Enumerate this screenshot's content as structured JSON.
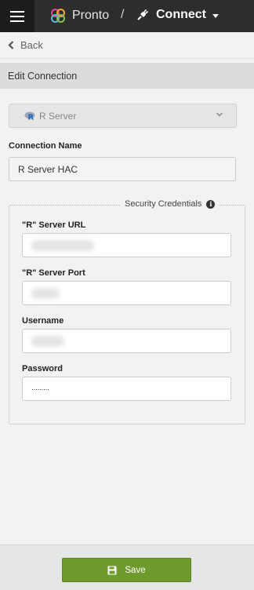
{
  "header": {
    "app_name": "Pronto",
    "separator": "/",
    "section": "Connect",
    "icons": {
      "menu": "hamburger-icon",
      "brand": "pronto-logo-icon",
      "section": "plug-icon",
      "caret": "caret-down-icon"
    }
  },
  "nav": {
    "back_label": "Back"
  },
  "page": {
    "title": "Edit Connection"
  },
  "connection_type": {
    "selected": "R Server"
  },
  "connection_name": {
    "label": "Connection Name",
    "value": "R Server HAC"
  },
  "credentials": {
    "legend": "Security Credentials",
    "url": {
      "label": "\"R\" Server URL"
    },
    "port": {
      "label": "\"R\" Server Port"
    },
    "username": {
      "label": "Username"
    },
    "password": {
      "label": "Password",
      "value": "·········"
    }
  },
  "footer": {
    "save_label": "Save"
  },
  "colors": {
    "topbar": "#2d2d2d",
    "save": "#6f9a2e",
    "title_bar": "#dcdcdc"
  }
}
